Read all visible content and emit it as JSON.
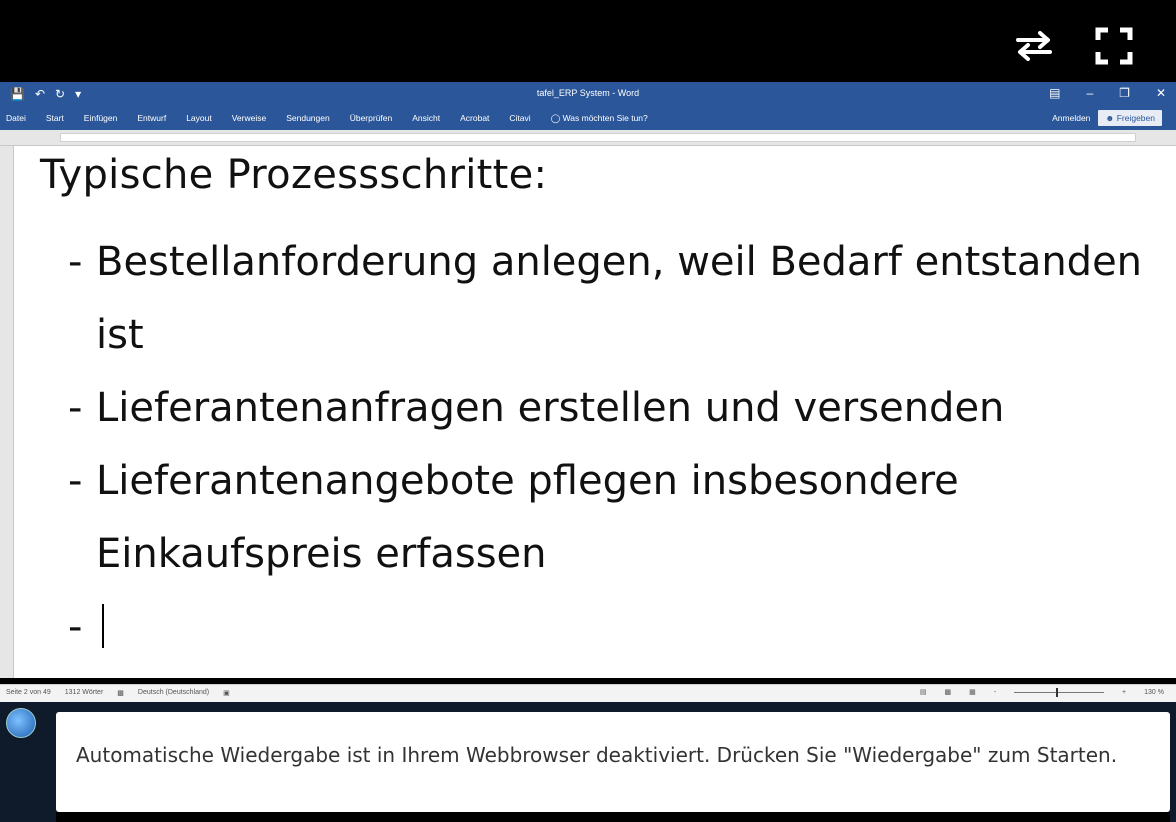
{
  "player": {
    "swap_icon": "swap-arrows-icon",
    "fullscreen_icon": "fullscreen-icon"
  },
  "word": {
    "title": "tafel_ERP System - Word",
    "quick_access": [
      "save-icon",
      "undo-icon",
      "redo-icon",
      "customize-icon"
    ],
    "window_controls": [
      "ribbon-display-icon",
      "minimize-icon",
      "restore-icon",
      "close-icon"
    ]
  },
  "ribbon": {
    "tabs": [
      "Datei",
      "Start",
      "Einfügen",
      "Entwurf",
      "Layout",
      "Verweise",
      "Sendungen",
      "Überprüfen",
      "Ansicht",
      "Acrobat",
      "Citavi",
      "Was möchten Sie tun?"
    ],
    "signin": "Anmelden",
    "share": "Freigeben"
  },
  "document": {
    "heading": "Typische Prozessschritte:",
    "bullets": [
      "Bestellanforderung anlegen, weil Bedarf entstanden ist",
      "Lieferantenanfragen erstellen und versenden",
      "Lieferantenangebote pflegen insbesondere Einkaufspreis erfassen",
      ""
    ],
    "dash": "-"
  },
  "status": {
    "page": "Seite 2 von 49",
    "words": "1312 Wörter",
    "language": "Deutsch (Deutschland)",
    "zoom": "130 %",
    "zoom_minus": "-",
    "zoom_plus": "+"
  },
  "notice": {
    "text": "Automatische Wiedergabe ist in Ihrem Webbrowser deaktiviert. Drücken Sie \"Wiedergabe\" zum Starten."
  }
}
